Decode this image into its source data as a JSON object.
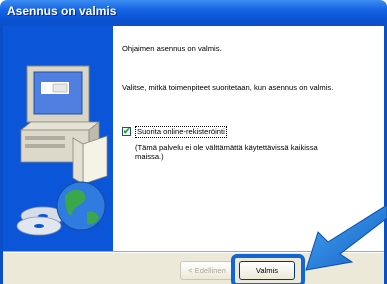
{
  "window": {
    "title": "Asennus on valmis"
  },
  "content": {
    "line1": "Ohjaimen asennus on valmis.",
    "line2": "Valitse, mitkä toimenpiteet suoritetaan, kun asennus on valmis.",
    "checkbox_label": "Suorita online-rekisteröinti",
    "checkbox_checked": true,
    "note_line1": "(Tämä palvelu ei ole välttämättä käytettävissä kaikissa",
    "note_line2": "maissa.)"
  },
  "buttons": {
    "prev_label": "< Edellinen",
    "finish_label": "Valmis"
  },
  "colors": {
    "titlebar": "#0b4fc8",
    "art_panel": "#0b56d8",
    "highlight": "#1266d4",
    "arrow": "#1a7ad9"
  }
}
